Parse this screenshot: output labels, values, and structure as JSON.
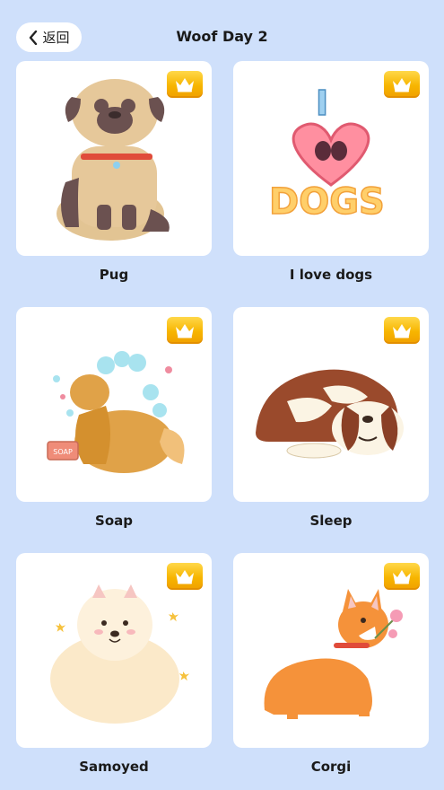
{
  "header": {
    "back_label": "返回",
    "title": "Woof Day 2"
  },
  "cards": [
    {
      "label": "Pug",
      "art": "pug"
    },
    {
      "label": "I love dogs",
      "art": "i-love-dogs",
      "art_text": [
        "I",
        "DOGS"
      ]
    },
    {
      "label": "Soap",
      "art": "soap",
      "art_text": "SOAP"
    },
    {
      "label": "Sleep",
      "art": "sleep"
    },
    {
      "label": "Samoyed",
      "art": "samoyed"
    },
    {
      "label": "Corgi",
      "art": "corgi"
    }
  ],
  "colors": {
    "background": "#cfe0fb",
    "card": "#ffffff",
    "crown_badge": "#f7b500"
  }
}
